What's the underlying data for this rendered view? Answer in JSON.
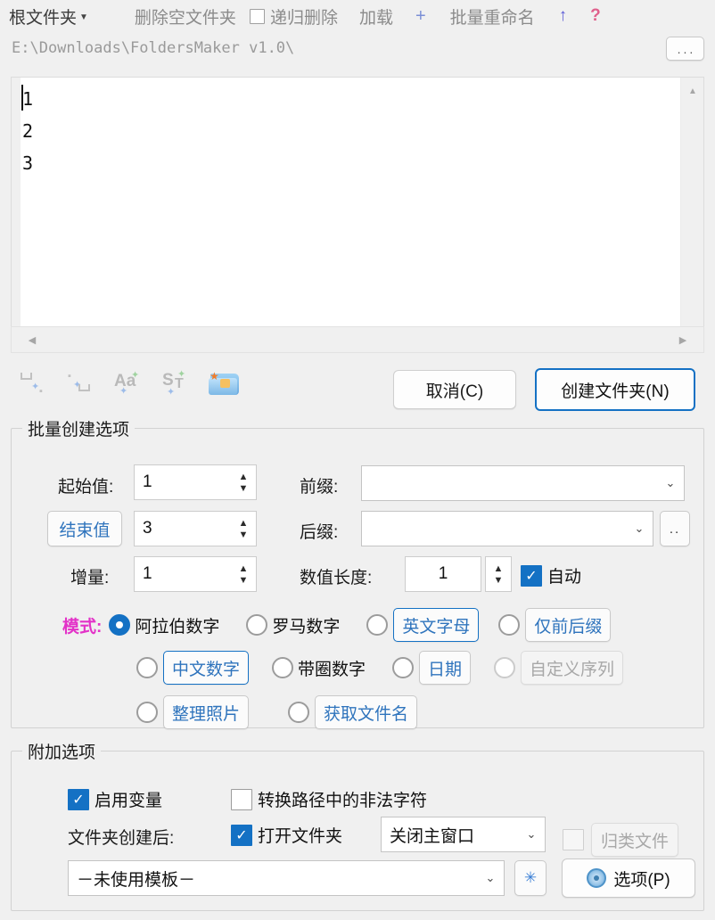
{
  "toolbar": {
    "root_folder": "根文件夹",
    "delete_empty": "删除空文件夹",
    "recursive_delete": "递归删除",
    "recursive_checked": false,
    "load": "加载",
    "plus": "+",
    "batch_rename": "批量重命名",
    "up": "↑",
    "help": "?"
  },
  "path": {
    "value": "E:\\Downloads\\FoldersMaker v1.0\\",
    "browse_label": "..."
  },
  "editor": {
    "lines": [
      "1",
      "2",
      "3"
    ],
    "scroll_up": "▲",
    "scroll_down": "▼",
    "scroll_left": "◀",
    "scroll_right": "▶"
  },
  "actions": {
    "cancel": "取消(C)",
    "create": "创建文件夹(N)"
  },
  "batch_group": {
    "title": "批量创建选项",
    "start_label": "起始值:",
    "start_value": "1",
    "end_label": "结束值",
    "end_value": "3",
    "step_label": "增量:",
    "step_value": "1",
    "prefix_label": "前缀:",
    "prefix_value": "",
    "suffix_label": "后缀:",
    "suffix_value": "",
    "suffix_browse": "..",
    "numlen_label": "数值长度:",
    "numlen_value": "1",
    "auto_label": "自动",
    "auto_checked": true,
    "mode_label": "模式:",
    "modes": [
      {
        "label": "阿拉伯数字",
        "checked": true,
        "style": "plain",
        "disabled": false
      },
      {
        "label": "罗马数字",
        "checked": false,
        "style": "plain",
        "disabled": false
      },
      {
        "label": "英文字母",
        "checked": false,
        "style": "blue-btn",
        "disabled": false
      },
      {
        "label": "仅前后缀",
        "checked": false,
        "style": "grey-btn",
        "disabled": false
      },
      {
        "label": "中文数字",
        "checked": false,
        "style": "blue-btn",
        "disabled": false
      },
      {
        "label": "带圈数字",
        "checked": false,
        "style": "plain",
        "disabled": false
      },
      {
        "label": "日期",
        "checked": false,
        "style": "grey-btn",
        "disabled": false
      },
      {
        "label": "自定义序列",
        "checked": false,
        "style": "grey-btn",
        "disabled": true
      },
      {
        "label": "整理照片",
        "checked": false,
        "style": "grey-btn",
        "disabled": false
      },
      {
        "label": "获取文件名",
        "checked": false,
        "style": "grey-btn",
        "disabled": false
      }
    ]
  },
  "extra_group": {
    "title": "附加选项",
    "enable_vars_label": "启用变量",
    "enable_vars_checked": true,
    "convert_illegal_label": "转换路径中的非法字符",
    "convert_illegal_checked": false,
    "after_create_label": "文件夹创建后:",
    "open_folder_label": "打开文件夹",
    "open_folder_checked": true,
    "window_action_value": "关闭主窗口",
    "classify_label": "归类文件",
    "classify_checked": false,
    "template_value": "－未使用模板－",
    "star_label": "✳",
    "options_label": "选项(P)"
  },
  "colors": {
    "accent": "#1471c4",
    "mode_label": "#e332c8",
    "help": "#e0608c",
    "up_arrow": "#5b5bd6",
    "window_bg": "#f0f0f0"
  }
}
